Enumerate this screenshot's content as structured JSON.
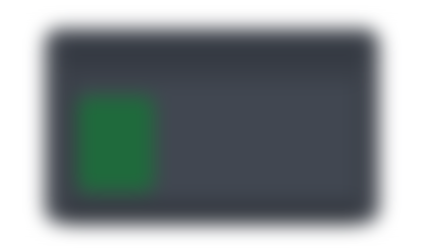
{
  "window": {
    "title": "",
    "status": ""
  },
  "colors": {
    "background": "#ffffff",
    "window": "#3a3f48",
    "window_dark": "#2f343d",
    "panel": "#414751",
    "accent": "#1f6a3c"
  }
}
